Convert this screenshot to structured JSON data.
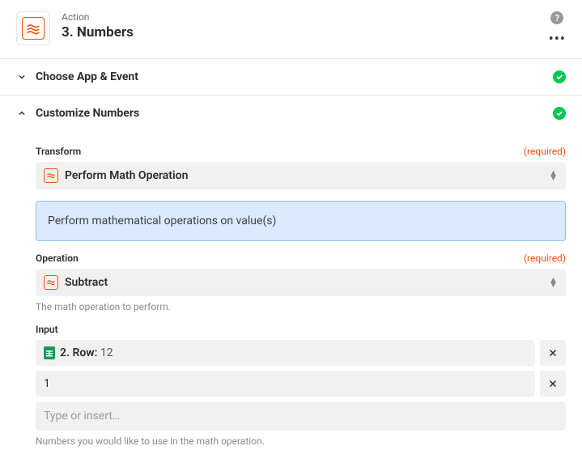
{
  "header": {
    "label": "Action",
    "title": "3. Numbers"
  },
  "sections": {
    "choose": {
      "title": "Choose App & Event"
    },
    "customize": {
      "title": "Customize Numbers"
    }
  },
  "transform": {
    "label": "Transform",
    "required_text": "(required)",
    "value": "Perform Math Operation",
    "description": "Perform mathematical operations on value(s)"
  },
  "operation": {
    "label": "Operation",
    "required_text": "(required)",
    "value": "Subtract",
    "help": "The math operation to perform."
  },
  "input": {
    "label": "Input",
    "items": [
      {
        "source": "sheets",
        "key": "2. Row:",
        "value": " 12"
      },
      {
        "source": "plain",
        "key": "1",
        "value": ""
      }
    ],
    "placeholder": "Type or insert…",
    "help": "Numbers you would like to use in the math operation."
  }
}
